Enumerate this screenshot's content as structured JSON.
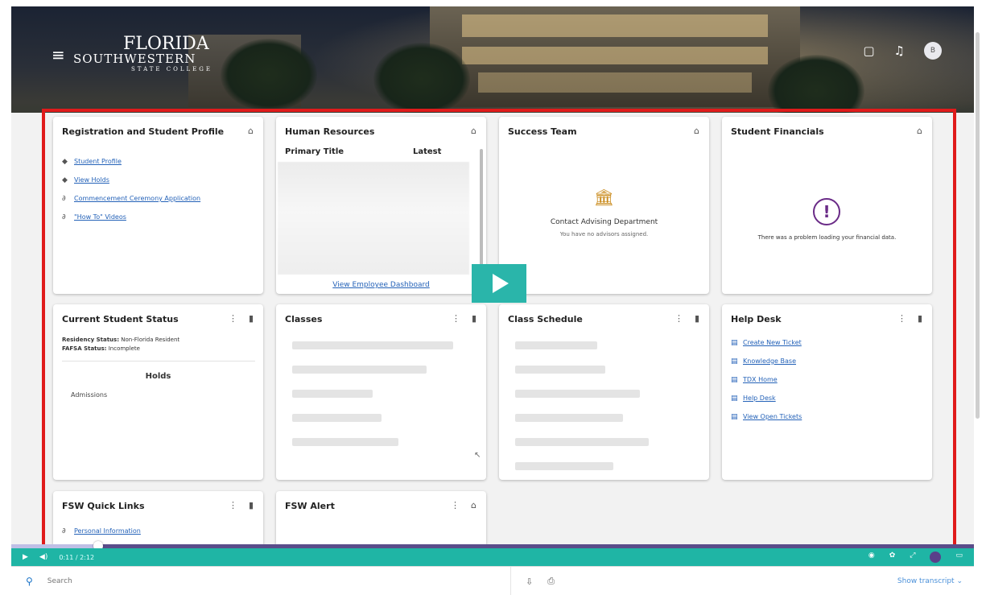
{
  "header": {
    "logo": {
      "line1": "FLORIDA",
      "line2": "SOUTHWESTERN",
      "line3": "STATE COLLEGE"
    },
    "avatar_initial": "B"
  },
  "cards": {
    "registration": {
      "title": "Registration and Student Profile",
      "links": [
        "Student Profile",
        "View Holds",
        "Commencement Ceremony Application",
        "\"How To\" Videos"
      ]
    },
    "human_resources": {
      "title": "Human Resources",
      "col1": "Primary Title",
      "col2": "Latest",
      "link": "View Employee Dashboard"
    },
    "success_team": {
      "title": "Success Team",
      "heading": "Contact Advising Department",
      "sub": "You have no advisors assigned."
    },
    "student_financials": {
      "title": "Student Financials",
      "message": "There was a problem loading your financial data."
    },
    "current_student_status": {
      "title": "Current Student Status",
      "residency_label": "Residency Status:",
      "residency_value": "Non-Florida Resident",
      "fafsa_label": "FAFSA Status:",
      "fafsa_value": "Incomplete",
      "holds_heading": "Holds",
      "holds_item": "Admissions"
    },
    "classes": {
      "title": "Classes"
    },
    "class_schedule": {
      "title": "Class Schedule"
    },
    "help_desk": {
      "title": "Help Desk",
      "links": [
        "Create New Ticket",
        "Knowledge Base",
        "TDX Home",
        "Help Desk",
        "View Open Tickets"
      ]
    },
    "quick_links": {
      "title": "FSW Quick Links",
      "links": [
        "Personal Information"
      ]
    },
    "fsw_alert": {
      "title": "FSW Alert"
    }
  },
  "player": {
    "time": "0:11 / 2:12",
    "progress": 0.09,
    "search_placeholder": "Search",
    "show_transcript": "Show transcript"
  },
  "colors": {
    "highlight": "#e01b1b",
    "player_bar": "#1fb5a5",
    "link": "#2462b8"
  }
}
